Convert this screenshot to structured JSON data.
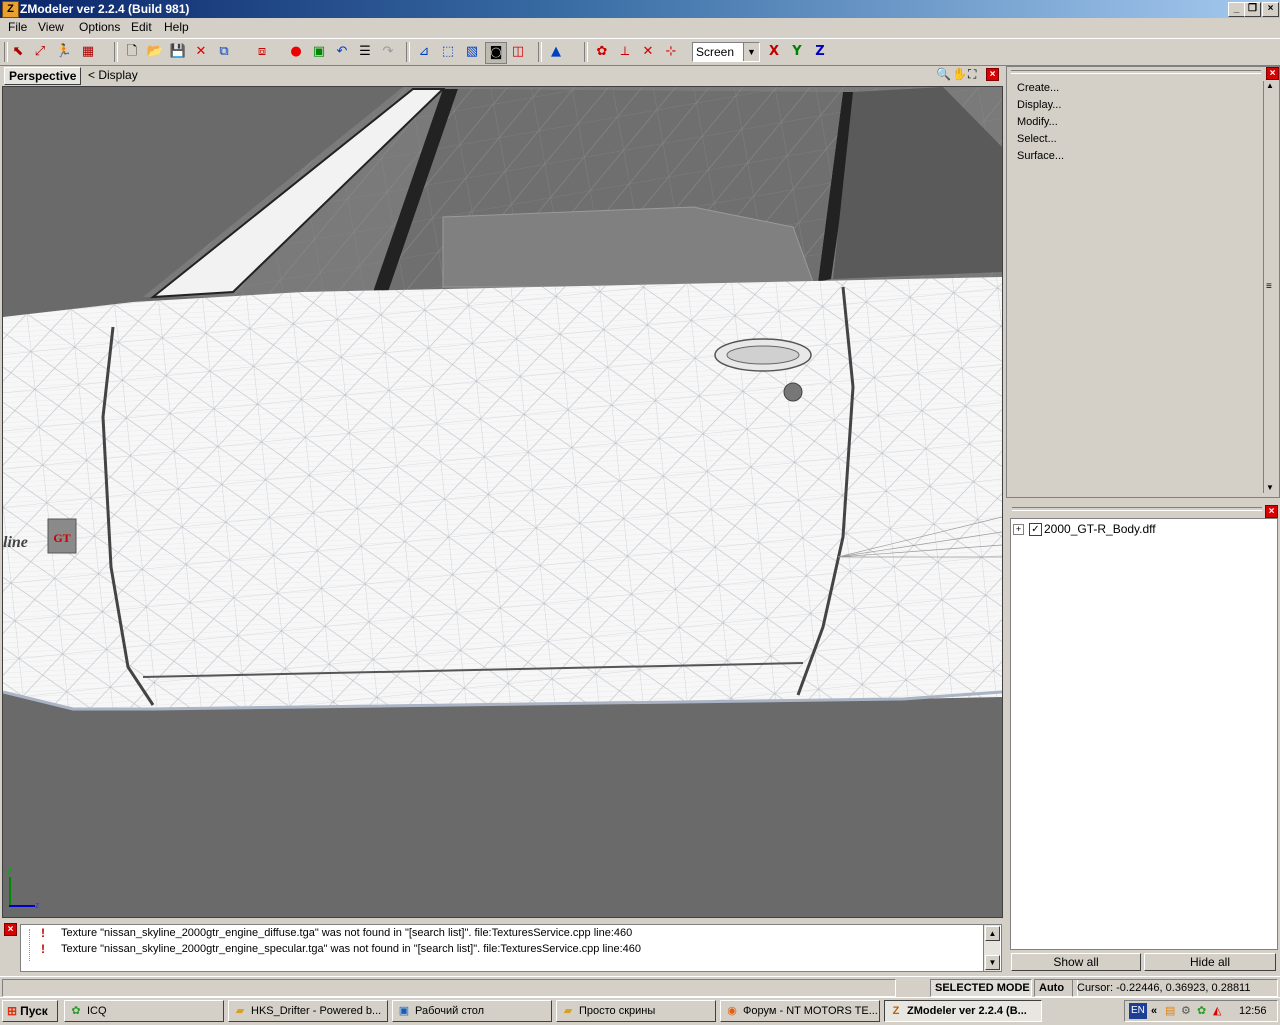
{
  "window": {
    "title": "ZModeler ver 2.2.4 (Build 981)",
    "app_icon": "Z",
    "buttons": [
      "minimize",
      "restore",
      "close"
    ]
  },
  "menu": [
    {
      "label": "File",
      "u": "F"
    },
    {
      "label": "View",
      "u": "V"
    },
    {
      "label": "Options",
      "u": "O"
    },
    {
      "label": "Edit",
      "u": "E"
    },
    {
      "label": "Help",
      "u": "H"
    }
  ],
  "toolbar": {
    "icons": [
      "select-tool-icon",
      "select-move-icon",
      "run-icon",
      "multi-select-icon",
      "new-file-icon",
      "open-folder-icon",
      "save-icon",
      "delete-icon",
      "import-icon",
      "export-icon",
      "record-icon",
      "snapshot-icon",
      "undo-icon",
      "properties-icon",
      "redo-icon",
      "vertex-mode-icon",
      "cube-wire-icon",
      "cube-solid-icon",
      "cube-selected-icon",
      "cube-red-icon",
      "axis-arrow-icon",
      "texture-icon",
      "axis-xy-icon",
      "axis-yz-icon",
      "axis-xz-icon"
    ],
    "coord_system": "Screen",
    "axis_labels": [
      "X",
      "Y",
      "Z"
    ],
    "axis_colors": [
      "#c00000",
      "#008000",
      "#0000c0"
    ]
  },
  "viewport": {
    "tab": "Perspective",
    "display_label": "< Display",
    "axis_y": "y",
    "axis_z": "z"
  },
  "commands": {
    "items": [
      "Create...",
      "Display...",
      "Modify...",
      "Select...",
      "Surface..."
    ]
  },
  "tree": {
    "items": [
      {
        "label": "2000_GT-R_Body.dff",
        "checked": true,
        "expand": "+"
      }
    ]
  },
  "panel_buttons": {
    "show_all": "Show all",
    "hide_all": "Hide all"
  },
  "log": {
    "lines": [
      "Texture \"nissan_skyline_2000gtr_engine_diffuse.tga\" was not found in \"[search list]\". file:TexturesService.cpp line:460",
      "Texture \"nissan_skyline_2000gtr_engine_specular.tga\" was not found in \"[search list]\". file:TexturesService.cpp line:460"
    ],
    "icon": "!"
  },
  "status": {
    "mode": "SELECTED MODE",
    "auto": "Auto",
    "cursor": "Cursor: -0.22446, 0.36923, 0.28811"
  },
  "taskbar": {
    "start": "Пуск",
    "tasks": [
      {
        "label": "ICQ",
        "icon": "icq-flower-icon",
        "active": false
      },
      {
        "label": "HKS_Drifter - Powered b...",
        "icon": "folder-icon",
        "active": false
      },
      {
        "label": "Рабочий стол",
        "icon": "desktop-icon",
        "active": false
      },
      {
        "label": "Просто скрины",
        "icon": "folder-icon",
        "active": false
      },
      {
        "label": "Форум - NT MOTORS TE...",
        "icon": "firefox-icon",
        "active": false
      },
      {
        "label": "ZModeler ver 2.2.4 (B...",
        "icon": "zmodeler-icon",
        "active": true
      }
    ],
    "tray": {
      "lang": "EN",
      "chevron": "«",
      "time": "12:56"
    }
  }
}
